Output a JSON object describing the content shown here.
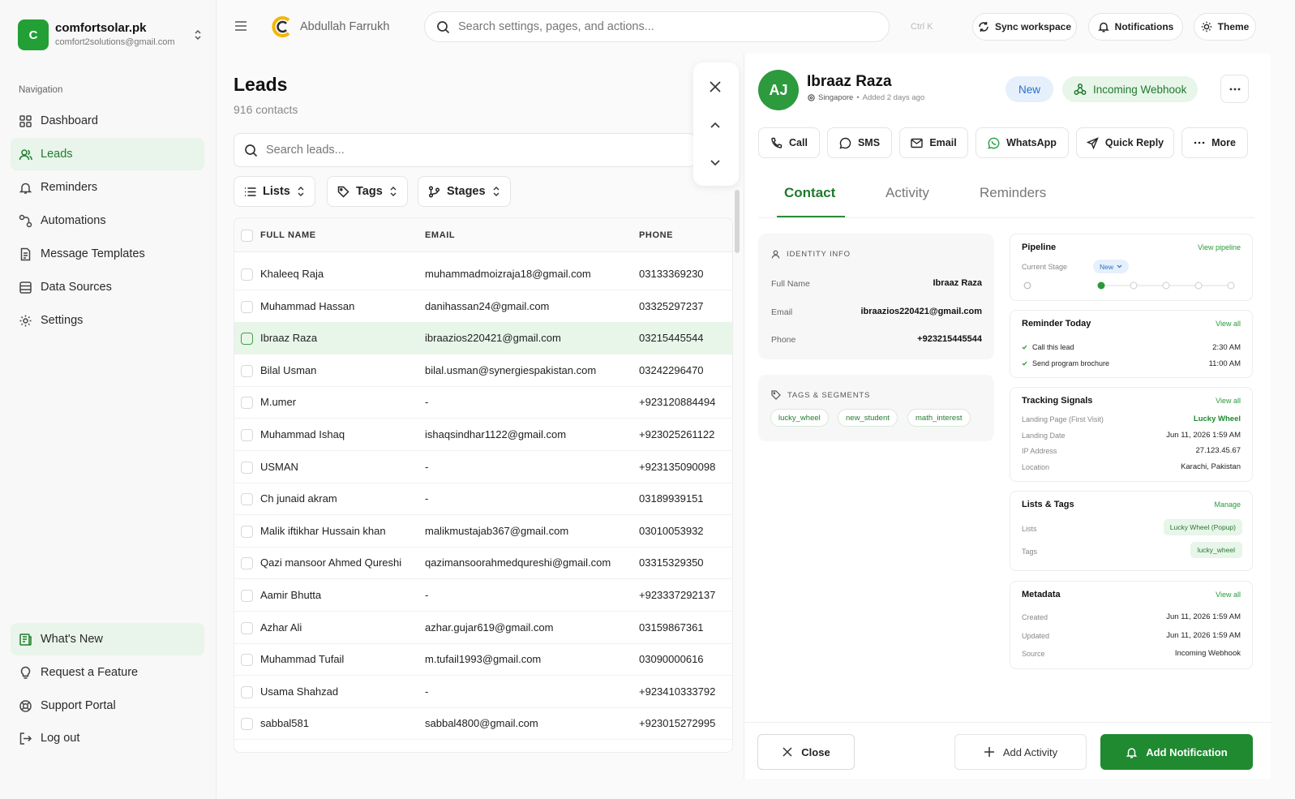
{
  "org": {
    "initial": "C",
    "name": "comfortsolar.pk",
    "email": "comfort2solutions@gmail.com"
  },
  "nav": {
    "heading": "Navigation",
    "items": [
      {
        "label": "Dashboard",
        "icon": "grid-icon"
      },
      {
        "label": "Leads",
        "icon": "users-icon",
        "active": true
      },
      {
        "label": "Reminders",
        "icon": "bell-icon"
      },
      {
        "label": "Automations",
        "icon": "workflow-icon"
      },
      {
        "label": "Message Templates",
        "icon": "file-icon"
      },
      {
        "label": "Data Sources",
        "icon": "database-icon"
      },
      {
        "label": "Settings",
        "icon": "gear-icon"
      }
    ],
    "bottom": [
      {
        "label": "What's New",
        "icon": "news-icon"
      },
      {
        "label": "Request a Feature",
        "icon": "lightbulb-icon"
      },
      {
        "label": "Support Portal",
        "icon": "lifebuoy-icon"
      },
      {
        "label": "Log out",
        "icon": "logout-icon"
      }
    ]
  },
  "topbar": {
    "user_name": "Abdullah Farrukh",
    "search_placeholder": "Search settings, pages, and actions...",
    "shortcut": "Ctrl K",
    "sync_label": "Sync workspace",
    "notifications_label": "Notifications",
    "theme_label": "Theme"
  },
  "leads": {
    "title": "Leads",
    "count": "916 contacts",
    "search_placeholder": "Search leads...",
    "filters": {
      "lists": "Lists",
      "tags": "Tags",
      "stages": "Stages"
    },
    "columns": {
      "name": "FULL NAME",
      "email": "EMAIL",
      "phone": "PHONE"
    },
    "rows": [
      {
        "name": "Khaleeq Raja",
        "email": "muhammadmoizraja18@gmail.com",
        "phone": "03133369230"
      },
      {
        "name": "Muhammad Hassan",
        "email": "danihassan24@gmail.com",
        "phone": "03325297237"
      },
      {
        "name": "Ibraaz Raza",
        "email": "ibraazios220421@gmail.com",
        "phone": "03215445544",
        "selected": true
      },
      {
        "name": "Bilal Usman",
        "email": "bilal.usman@synergiespakistan.com",
        "phone": "03242296470"
      },
      {
        "name": "M.umer",
        "email": "-",
        "phone": "+923120884494"
      },
      {
        "name": "Muhammad Ishaq",
        "email": "ishaqsindhar1122@gmail.com",
        "phone": "+923025261122"
      },
      {
        "name": "USMAN",
        "email": "-",
        "phone": "+923135090098"
      },
      {
        "name": "Ch junaid akram",
        "email": "-",
        "phone": "03189939151"
      },
      {
        "name": "Malik iftikhar Hussain khan",
        "email": "malikmustajab367@gmail.com",
        "phone": "03010053932"
      },
      {
        "name": "Qazi mansoor Ahmed Qureshi",
        "email": "qazimansoorahmedqureshi@gmail.com",
        "phone": "03315329350"
      },
      {
        "name": "Aamir Bhutta",
        "email": "-",
        "phone": "+923337292137"
      },
      {
        "name": "Azhar Ali",
        "email": "azhar.gujar619@gmail.com",
        "phone": "03159867361"
      },
      {
        "name": "Muhammad Tufail",
        "email": "m.tufail1993@gmail.com",
        "phone": "03090000616"
      },
      {
        "name": "Usama Shahzad",
        "email": "-",
        "phone": "+923410333792"
      },
      {
        "name": "sabbal581",
        "email": "sabbal4800@gmail.com",
        "phone": "+923015272995"
      }
    ]
  },
  "drawer": {
    "initials": "AJ",
    "name": "Ibraaz Raza",
    "location": "Singapore",
    "added": "Added 2 days ago",
    "status_badge": "New",
    "source_badge": "Incoming Webhook",
    "actions": [
      "Call",
      "SMS",
      "Email",
      "WhatsApp",
      "Quick Reply",
      "More"
    ],
    "tabs": [
      "Contact",
      "Activity",
      "Reminders"
    ],
    "identity": {
      "label": "IDENTITY INFO",
      "full_name_label": "Full Name",
      "full_name": "Ibraaz Raza",
      "email_label": "Email",
      "email": "ibraazios220421@gmail.com",
      "phone_label": "Phone",
      "phone": "+923215445544"
    },
    "tags": {
      "label": "TAGS & SEGMENTS",
      "items": [
        "lucky_wheel",
        "new_student",
        "math_interest"
      ]
    },
    "pipeline": {
      "title": "Pipeline",
      "link": "View pipeline",
      "stage_label": "Current Stage",
      "stage": "New",
      "steps_total": 5,
      "current_step": 1
    },
    "reminder": {
      "title": "Reminder Today",
      "link": "View all",
      "items": [
        {
          "text": "Call this lead",
          "time": "2:30 AM"
        },
        {
          "text": "Send program brochure",
          "time": "11:00 AM"
        }
      ]
    },
    "tracking": {
      "title": "Tracking Signals",
      "link": "View all",
      "items": [
        {
          "k": "Landing Page (First Visit)",
          "v": "Lucky Wheel",
          "green": true
        },
        {
          "k": "Landing Date",
          "v": "Jun 11, 2026 1:59 AM"
        },
        {
          "k": "IP Address",
          "v": "27.123.45.67"
        },
        {
          "k": "Location",
          "v": "Karachi, Pakistan"
        }
      ]
    },
    "lists_tags": {
      "title": "Lists & Tags",
      "link": "Manage",
      "lists_label": "Lists",
      "lists_value": "Lucky Wheel (Popup)",
      "tags_label": "Tags",
      "tags_value": "lucky_wheel"
    },
    "metadata": {
      "title": "Metadata",
      "link": "View all",
      "items": [
        {
          "k": "Created",
          "v": "Jun 11, 2026 1:59 AM"
        },
        {
          "k": "Updated",
          "v": "Jun 11, 2026 1:59 AM"
        },
        {
          "k": "Source",
          "v": "Incoming Webhook"
        }
      ]
    },
    "footer": {
      "close": "Close",
      "add_activity": "Add Activity",
      "add_notification": "Add Notification"
    }
  },
  "colors": {
    "accent": "#1f8a30",
    "accent_light": "#e8f5e9",
    "new_badge": "#2a6fc5"
  }
}
